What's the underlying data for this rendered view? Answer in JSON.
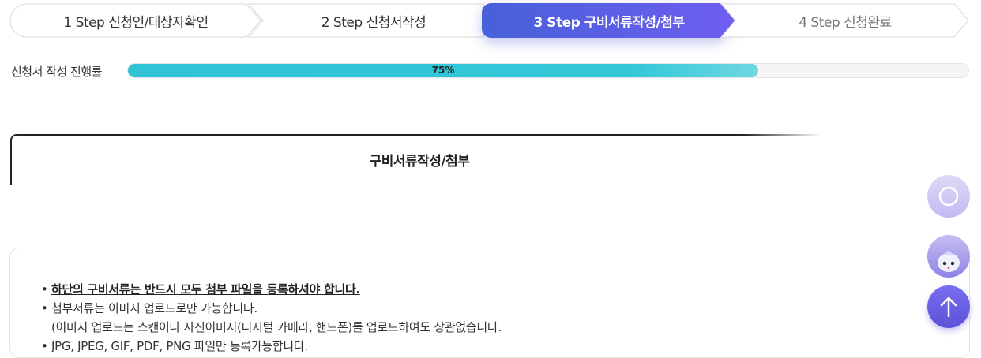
{
  "steps": [
    {
      "label": "1 Step 신청인/대상자확인",
      "state": "done"
    },
    {
      "label": "2 Step 신청서작성",
      "state": "done"
    },
    {
      "label": "3 Step 구비서류작성/첨부",
      "state": "active"
    },
    {
      "label": "4 Step 신청완료",
      "state": "pending"
    }
  ],
  "progress": {
    "label": "신청서 작성 진행률",
    "percent_text": "75%",
    "value": 0.75
  },
  "section": {
    "title": "구비서류작성/첨부"
  },
  "notice": {
    "items": [
      {
        "bullet": "•",
        "text": "하단의 구비서류는 반드시 모두 첨부 파일을 등록하셔야 합니다."
      },
      {
        "bullet": "•",
        "text": "첨부서류는 이미지 업로드로만 가능합니다."
      },
      {
        "bullet": "",
        "text": "(이미지 업로드는 스캔이나 사진이미지(디지털 카메라, 핸드폰)를 업로드하여도 상관없습니다."
      },
      {
        "bullet": "•",
        "text": "JPG, JPEG, GIF, PDF, PNG 파일만 등록가능합니다."
      }
    ]
  },
  "colors": {
    "active_step_start": "#4a5fd8",
    "active_step_end": "#6a5cf0",
    "progress_fill": "#2ec4d6"
  },
  "floating": {
    "icons": [
      "help-icon",
      "chatbot-icon",
      "arrow-up-icon"
    ]
  }
}
